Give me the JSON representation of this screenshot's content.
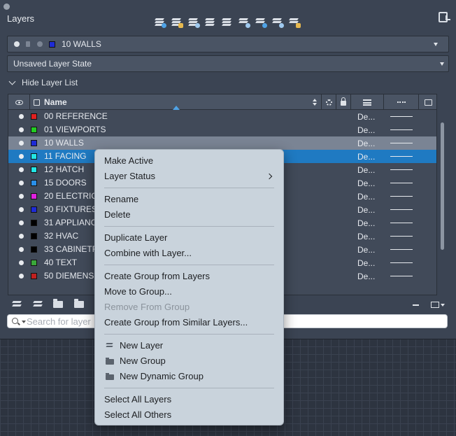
{
  "panel": {
    "title": "Layers",
    "toolbar_icons": [
      "new-layer-icon",
      "new-layer-vp-frozen-icon",
      "delete-layer-icon",
      "set-current-icon",
      "layer-walk-icon",
      "freeze-icon",
      "isolate-icon",
      "lock-icon",
      "unlock-icon"
    ],
    "settings_icon": "panel-settings-icon"
  },
  "current_layer": {
    "name": "10 WALLS",
    "color": "#1e2bd6"
  },
  "layer_state": {
    "value": "Unsaved Layer State"
  },
  "hide_list_label": "Hide Layer List",
  "table": {
    "name_header": "Name",
    "rows": [
      {
        "name": "00 REFERENCE",
        "color": "#e02020",
        "linetype": "De...",
        "state": "normal"
      },
      {
        "name": "01 VIEWPORTS",
        "color": "#22cc22",
        "linetype": "De...",
        "state": "normal"
      },
      {
        "name": "10 WALLS",
        "color": "#1e2bd6",
        "linetype": "De...",
        "state": "active"
      },
      {
        "name": "11 FACING",
        "color": "#22e6e6",
        "linetype": "De...",
        "state": "selected"
      },
      {
        "name": "12 HATCH",
        "color": "#22e6e6",
        "linetype": "De...",
        "state": "normal"
      },
      {
        "name": "15 DOORS",
        "color": "#2a8fe8",
        "linetype": "De...",
        "state": "normal"
      },
      {
        "name": "20 ELECTRICAL",
        "color": "#e020e0",
        "linetype": "De...",
        "state": "normal"
      },
      {
        "name": "30 FIXTURES",
        "color": "#1e2bd6",
        "linetype": "De...",
        "state": "normal"
      },
      {
        "name": "31 APPLIANCES",
        "color": "#000000",
        "linetype": "De...",
        "state": "normal"
      },
      {
        "name": "32 HVAC",
        "color": "#000000",
        "linetype": "De...",
        "state": "normal"
      },
      {
        "name": "33 CABINETRY",
        "color": "#000000",
        "linetype": "De...",
        "state": "normal"
      },
      {
        "name": "40 TEXT",
        "color": "#3aa83a",
        "linetype": "De...",
        "state": "normal"
      },
      {
        "name": "50 DIEMENSIONS",
        "color": "#c0201f",
        "linetype": "De...",
        "state": "normal"
      }
    ]
  },
  "search": {
    "placeholder": "Search for layer",
    "value": ""
  },
  "context_menu": {
    "groups": [
      [
        {
          "label": "Make Active",
          "name": "make-active-item"
        },
        {
          "label": "Layer Status",
          "name": "layer-status-item",
          "submenu": true
        }
      ],
      [
        {
          "label": "Rename",
          "name": "rename-item"
        },
        {
          "label": "Delete",
          "name": "delete-item"
        }
      ],
      [
        {
          "label": "Duplicate Layer",
          "name": "duplicate-layer-item"
        },
        {
          "label": "Combine with Layer...",
          "name": "combine-with-layer-item"
        }
      ],
      [
        {
          "label": "Create Group from Layers",
          "name": "create-group-from-layers-item"
        },
        {
          "label": "Move to Group...",
          "name": "move-to-group-item"
        },
        {
          "label": "Remove From Group",
          "name": "remove-from-group-item",
          "disabled": true
        },
        {
          "label": "Create Group from Similar Layers...",
          "name": "create-group-similar-item"
        }
      ],
      [
        {
          "label": "New Layer",
          "name": "new-layer-item",
          "icon": "layers"
        },
        {
          "label": "New Group",
          "name": "new-group-item",
          "icon": "fold"
        },
        {
          "label": "New Dynamic Group",
          "name": "new-dynamic-group-item",
          "icon": "fold"
        }
      ],
      [
        {
          "label": "Select All Layers",
          "name": "select-all-layers-item"
        },
        {
          "label": "Select All Others",
          "name": "select-all-others-item"
        }
      ]
    ]
  }
}
